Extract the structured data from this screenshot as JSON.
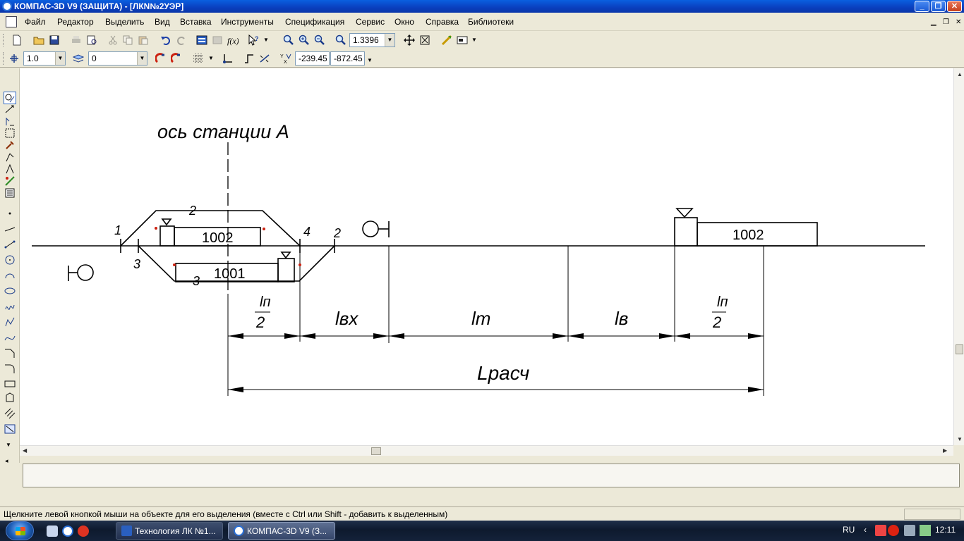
{
  "window": {
    "title": "КОМПАС-3D V9 (ЗАЩИТА) - [ЛКN№2УЭР]",
    "buttons": [
      "minimize",
      "restore",
      "close"
    ]
  },
  "menu": {
    "items": [
      "Файл",
      "Редактор",
      "Выделить",
      "Вид",
      "Вставка",
      "Инструменты",
      "Спецификация",
      "Сервис",
      "Окно",
      "Справка",
      "Библиотеки"
    ]
  },
  "toolbar1": {
    "zoom_value": "1.3396",
    "icons": [
      "new-icon",
      "open-icon",
      "save-icon",
      "print-icon",
      "preview-icon",
      "cut-icon",
      "copy-icon",
      "paste-icon",
      "undo-icon",
      "redo-icon",
      "manager-icon",
      "library-icon",
      "fx-icon",
      "help-pointer-icon",
      "zoom-window-icon",
      "zoom-in-icon",
      "zoom-out-icon",
      "zoom-scale-icon",
      "pan-icon",
      "fit-icon",
      "regenerate-icon",
      "display-mode-icon"
    ]
  },
  "toolbar2": {
    "step_value": "1.0",
    "layer_value": "0",
    "coord_x": "-239.45",
    "coord_y": "-872.45"
  },
  "drawing": {
    "axis_label": "ось станции А",
    "track_labels": [
      "2",
      "1",
      "4",
      "2",
      "3",
      "3"
    ],
    "train_top": "1002",
    "train_bottom": "1001",
    "train_right": "1002",
    "dims": {
      "ln_half_num": "lп",
      "ln_half_den": "2",
      "lvx": "lвх",
      "lt": "lт",
      "lv": "lв",
      "total": "Lрасч"
    }
  },
  "left_toolbar": {
    "icons": [
      "geometry-icon",
      "dimensions-icon",
      "symbols-icon",
      "edit-icon",
      "parametrization-icon",
      "measure-icon",
      "select-icon",
      "associative-views-icon",
      "spec-icon",
      "point-icon",
      "line-icon",
      "segment-icon",
      "circle-icon",
      "arc-icon",
      "ellipse-icon",
      "spline-icon",
      "polyline-icon",
      "bezier-icon",
      "chamfer-icon",
      "fillet-icon",
      "rectangle-icon",
      "polygon-icon",
      "hatch-icon",
      "macro-icon"
    ]
  },
  "status": {
    "hint": "Щелкните левой кнопкой мыши на объекте для его выделения (вместе с Ctrl или Shift - добавить к выделенным)"
  },
  "taskbar": {
    "tasks": [
      "Технология ЛК №1...",
      "КОМПАС-3D V9 (З..."
    ],
    "lang": "RU",
    "clock": "12:11"
  }
}
